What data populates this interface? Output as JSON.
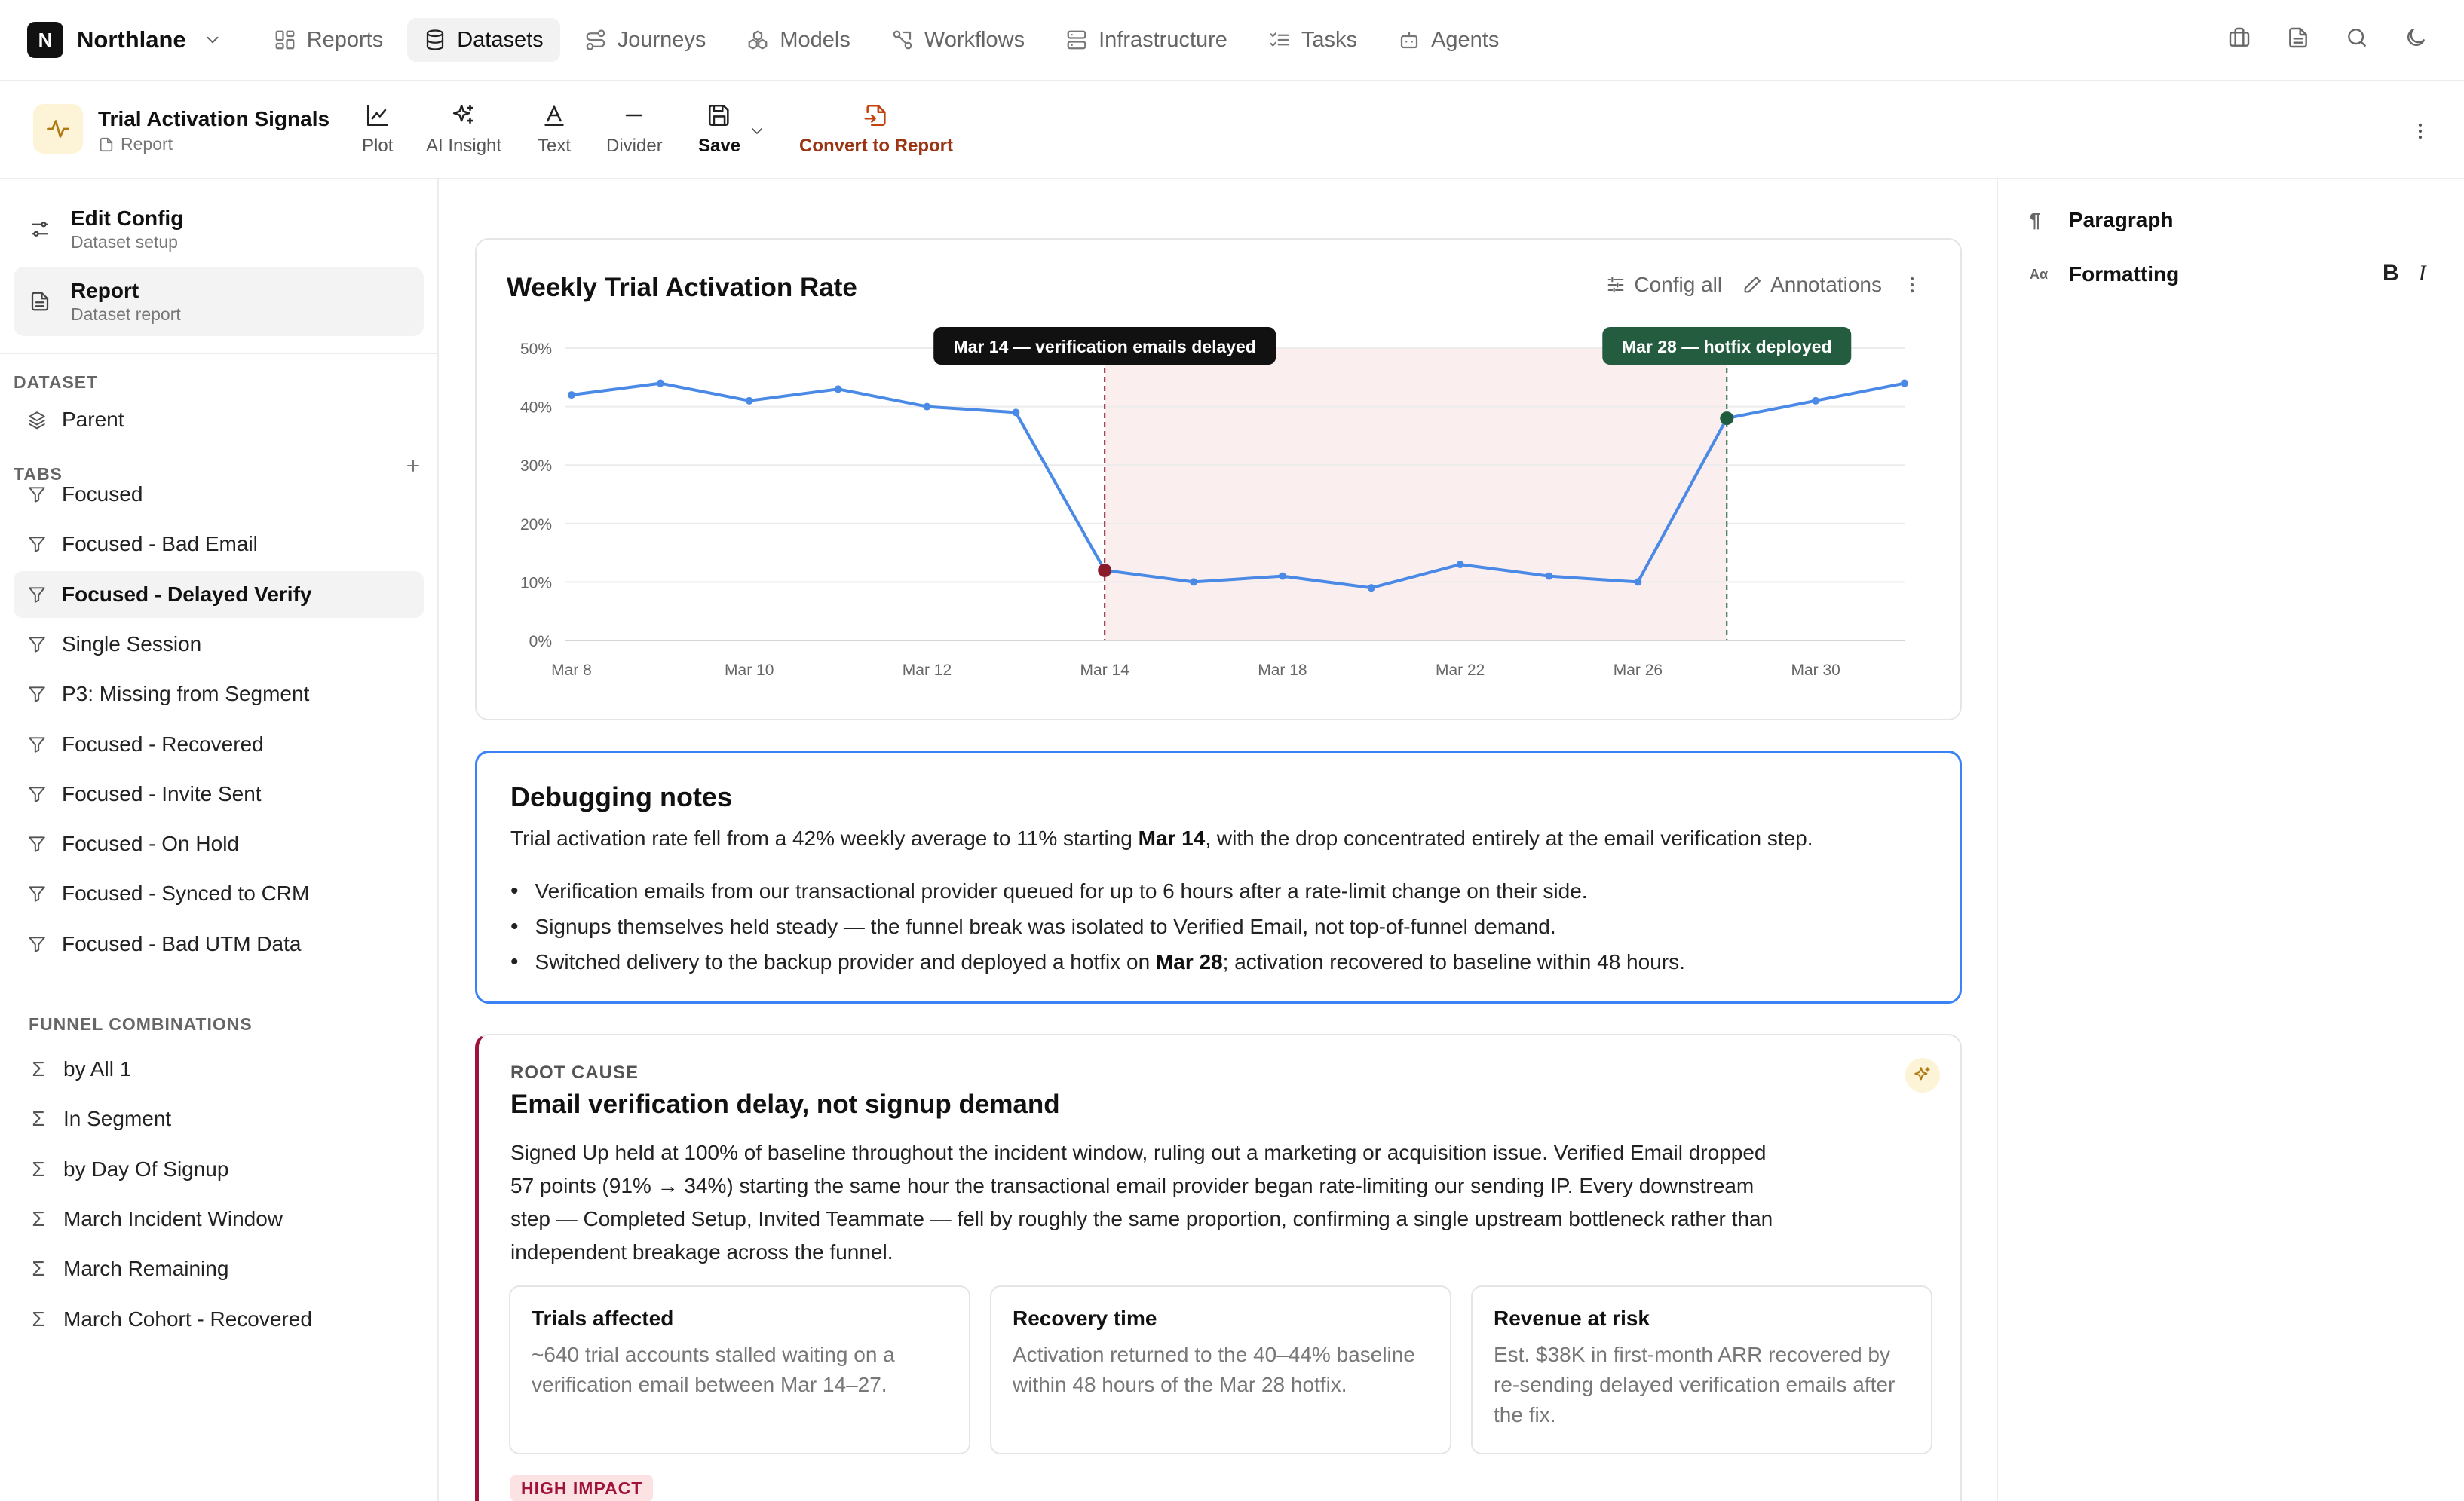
{
  "app": {
    "name": "Northlane",
    "logo_letter": "N"
  },
  "nav": [
    {
      "label": "Reports",
      "icon": "grid-icon",
      "active": false
    },
    {
      "label": "Datasets",
      "icon": "database-icon",
      "active": true
    },
    {
      "label": "Journeys",
      "icon": "route-icon",
      "active": false
    },
    {
      "label": "Models",
      "icon": "boxes-icon",
      "active": false
    },
    {
      "label": "Workflows",
      "icon": "workflow-icon",
      "active": false
    },
    {
      "label": "Infrastructure",
      "icon": "server-icon",
      "active": false
    },
    {
      "label": "Tasks",
      "icon": "checklist-icon",
      "active": false
    },
    {
      "label": "Agents",
      "icon": "bot-icon",
      "active": false
    }
  ],
  "top_icons": [
    "briefcase-icon",
    "document-icon",
    "search-icon",
    "moon-icon"
  ],
  "report": {
    "title": "Trial Activation Signals",
    "type": "Report"
  },
  "toolbar": {
    "plot": "Plot",
    "ai_insight": "AI Insight",
    "text": "Text",
    "divider": "Divider",
    "save": "Save",
    "convert": "Convert to Report"
  },
  "sidebar": {
    "edit_config": {
      "title": "Edit Config",
      "sub": "Dataset setup"
    },
    "report": {
      "title": "Report",
      "sub": "Dataset report"
    },
    "dataset_label": "DATASET",
    "parent": "Parent",
    "tabs_label": "TABS",
    "tabs": [
      "Focused",
      "Focused - Bad Email",
      "Focused - Delayed Verify",
      "Single Session",
      "P3: Missing from Segment",
      "Focused - Recovered",
      "Focused - Invite Sent",
      "Focused - On Hold",
      "Focused - Synced to CRM",
      "Focused - Bad UTM Data"
    ],
    "active_tab_index": 2,
    "funnel_label": "FUNNEL COMBINATIONS",
    "funnels": [
      "by All 1",
      "In Segment",
      "by Day Of Signup",
      "March Incident Window",
      "March Remaining",
      "March Cohort - Recovered"
    ]
  },
  "right_panel": {
    "paragraph": "Paragraph",
    "formatting": "Formatting",
    "bold": "B",
    "italic": "I"
  },
  "chart_card": {
    "config_all": "Config all",
    "annotations": "Annotations"
  },
  "chart_data": {
    "type": "line",
    "title": "Weekly Trial Activation Rate",
    "x_tick_labels": [
      "Mar 8",
      "Mar 10",
      "Mar 12",
      "Mar 14",
      "Mar 18",
      "Mar 22",
      "Mar 26",
      "Mar 30"
    ],
    "y_tick_labels": [
      "0%",
      "10%",
      "20%",
      "30%",
      "40%",
      "50%"
    ],
    "ylim": [
      0,
      50
    ],
    "grid": true,
    "series": [
      {
        "values": [
          42,
          44,
          41,
          43,
          40,
          39,
          12,
          10,
          11,
          9,
          13,
          11,
          10,
          38,
          41,
          44
        ],
        "color": "#4a8ae6"
      }
    ],
    "highlight_points": [
      {
        "index": 6,
        "color": "#8b1a2b"
      },
      {
        "index": 13,
        "color": "#1f5c3d"
      }
    ],
    "shaded_region": {
      "from_index": 6,
      "to_index": 13,
      "color": "#fbeeee"
    },
    "annotations": [
      {
        "index": 6,
        "label": "Mar 14 — verification emails delayed",
        "color": "#111111"
      },
      {
        "index": 13,
        "label": "Mar 28 — hotfix deployed",
        "color": "#245c40"
      }
    ]
  },
  "notes": {
    "title": "Debugging notes",
    "intro_a": "Trial activation rate fell from a 42% weekly average to 11% starting ",
    "intro_b": "Mar 14",
    "intro_c": ", with the drop concentrated entirely at the email verification step.",
    "bullet1": "Verification emails from our transactional provider queued for up to 6 hours after a rate-limit change on their side.",
    "bullet2": "Signups themselves held steady — the funnel break was isolated to Verified Email, not top-of-funnel demand.",
    "bullet3_a": "Switched delivery to the backup provider and deployed a hotfix on ",
    "bullet3_b": "Mar 28",
    "bullet3_c": "; activation recovered to baseline within 48 hours."
  },
  "insight": {
    "eyebrow": "ROOT CAUSE",
    "title": "Email verification delay, not signup demand",
    "body": "Signed Up held at 100% of baseline throughout the incident window, ruling out a marketing or acquisition issue. Verified Email dropped 57 points (91% → 34%) starting the same hour the transactional email provider began rate-limiting our sending IP. Every downstream step — Completed Setup, Invited Teammate — fell by roughly the same proportion, confirming a single upstream bottleneck rather than independent breakage across the funnel.",
    "stats": [
      {
        "title": "Trials affected",
        "body": "~640 trial accounts stalled waiting on a verification email between Mar 14–27."
      },
      {
        "title": "Recovery time",
        "body": "Activation returned to the 40–44% baseline within 48 hours of the Mar 28 hotfix."
      },
      {
        "title": "Revenue at risk",
        "body": "Est. $38K in first-month ARR recovered by re-sending delayed verification emails after the fix."
      }
    ],
    "badge": "HIGH IMPACT"
  }
}
